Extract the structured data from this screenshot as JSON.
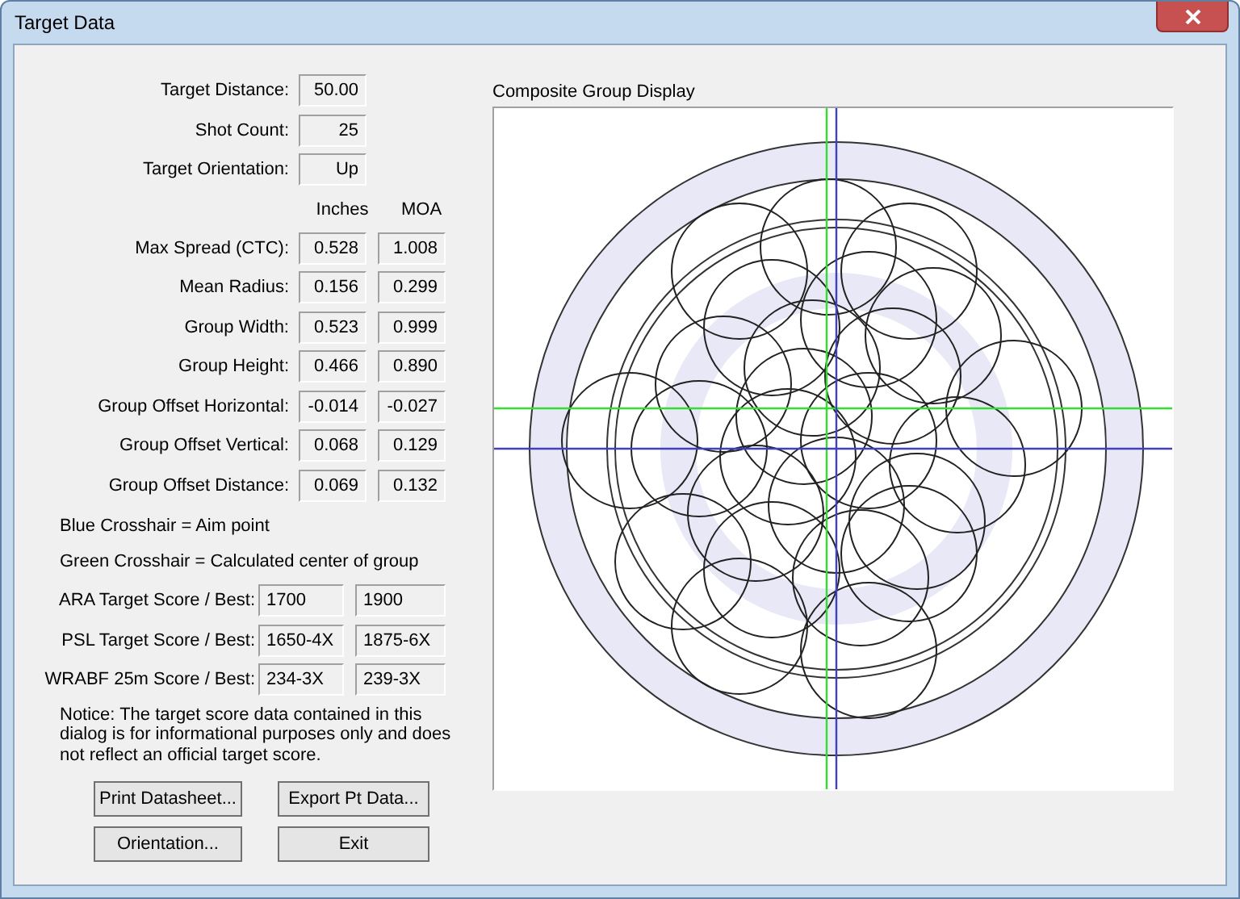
{
  "window": {
    "title": "Target Data"
  },
  "info_fields": [
    {
      "label": "Target Distance:",
      "value": "50.00"
    },
    {
      "label": "Shot Count:",
      "value": "25"
    },
    {
      "label": "Target Orientation:",
      "value": "Up"
    }
  ],
  "measure_columns": [
    "Inches",
    "MOA"
  ],
  "measurements": [
    {
      "label": "Max Spread (CTC):",
      "inches": "0.528",
      "moa": "1.008"
    },
    {
      "label": "Mean Radius:",
      "inches": "0.156",
      "moa": "0.299"
    },
    {
      "label": "Group Width:",
      "inches": "0.523",
      "moa": "0.999"
    },
    {
      "label": "Group Height:",
      "inches": "0.466",
      "moa": "0.890"
    },
    {
      "label": "Group Offset Horizontal:",
      "inches": "-0.014",
      "moa": "-0.027"
    },
    {
      "label": "Group Offset Vertical:",
      "inches": "0.068",
      "moa": "0.129"
    },
    {
      "label": "Group Offset Distance:",
      "inches": "0.069",
      "moa": "0.132"
    }
  ],
  "legend": [
    "Blue Crosshair = Aim point",
    "Green Crosshair = Calculated center of group"
  ],
  "scores": [
    {
      "label": "ARA Target Score / Best:",
      "score": "1700",
      "best": "1900"
    },
    {
      "label": "PSL Target Score / Best:",
      "score": "1650-4X",
      "best": "1875-6X"
    },
    {
      "label": "WRABF 25m Score / Best:",
      "score": "234-3X",
      "best": "239-3X"
    }
  ],
  "notice": "Notice: The target score data contained in this dialog is for informational purposes only and does not reflect an official target score.",
  "buttons": [
    "Print Datasheet...",
    "Export Pt Data...",
    "Orientation...",
    "Exit"
  ],
  "display": {
    "title": "Composite Group Display"
  }
}
